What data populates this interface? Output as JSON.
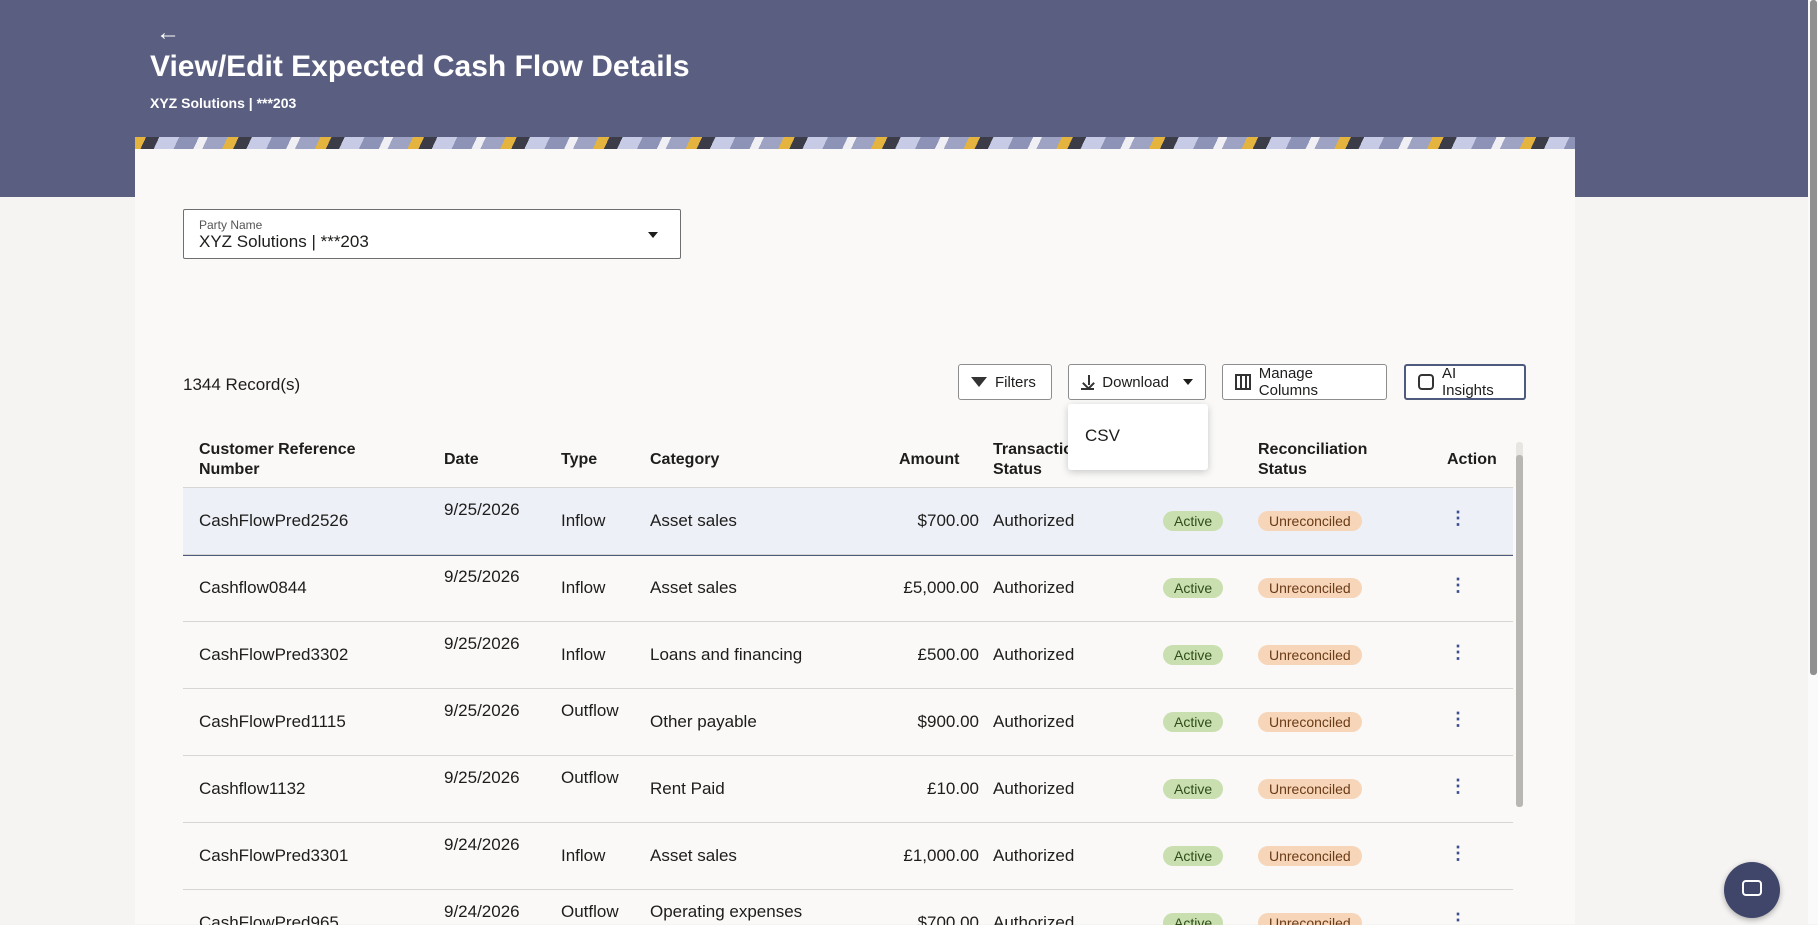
{
  "header": {
    "back_label": "←",
    "title": "View/Edit Expected Cash Flow Details",
    "subtitle": "XYZ Solutions | ***203"
  },
  "party": {
    "label": "Party Name",
    "value": "XYZ Solutions | ***203"
  },
  "records_count": "1344 Record(s)",
  "toolbar": {
    "filters_label": "Filters",
    "download_label": "Download",
    "manage_columns_label": "Manage Columns",
    "ai_insights_label": "AI Insights"
  },
  "download_menu": {
    "items": [
      "CSV"
    ]
  },
  "table": {
    "headers": {
      "ref": "Customer Reference Number",
      "date": "Date",
      "type": "Type",
      "category": "Category",
      "amount": "Amount",
      "txn_status": "Transaction Status",
      "recon_status": "Reconciliation Status",
      "action": "Action"
    },
    "rows": [
      {
        "ref": "CashFlowPred2526",
        "date": "9/25/2026",
        "type": "Inflow",
        "category": "Asset sales",
        "amount": "$700.00",
        "txn_status": "Authorized",
        "status": "Active",
        "recon": "Unreconciled"
      },
      {
        "ref": "Cashflow0844",
        "date": "9/25/2026",
        "type": "Inflow",
        "category": "Asset sales",
        "amount": "£5,000.00",
        "txn_status": "Authorized",
        "status": "Active",
        "recon": "Unreconciled"
      },
      {
        "ref": "CashFlowPred3302",
        "date": "9/25/2026",
        "type": "Inflow",
        "category": "Loans and financing",
        "amount": "£500.00",
        "txn_status": "Authorized",
        "status": "Active",
        "recon": "Unreconciled"
      },
      {
        "ref": "CashFlowPred1115",
        "date": "9/25/2026",
        "type": "Outflow",
        "category": "Other payable",
        "amount": "$900.00",
        "txn_status": "Authorized",
        "status": "Active",
        "recon": "Unreconciled"
      },
      {
        "ref": "Cashflow1132",
        "date": "9/25/2026",
        "type": "Outflow",
        "category": "Rent Paid",
        "amount": "£10.00",
        "txn_status": "Authorized",
        "status": "Active",
        "recon": "Unreconciled"
      },
      {
        "ref": "CashFlowPred3301",
        "date": "9/24/2026",
        "type": "Inflow",
        "category": "Asset sales",
        "amount": "£1,000.00",
        "txn_status": "Authorized",
        "status": "Active",
        "recon": "Unreconciled"
      },
      {
        "ref": "CashFlowPred965",
        "date": "9/24/2026",
        "type": "Outflow",
        "category": "Operating expenses",
        "amount": "$700.00",
        "txn_status": "Authorized",
        "status": "Active",
        "recon": "Unreconciled"
      }
    ]
  },
  "kebab_glyph": "⋮",
  "colors": {
    "banner": "#5a5f81",
    "active_badge": "#c9dfb0",
    "unreconciled_badge": "#f6d5b8"
  }
}
